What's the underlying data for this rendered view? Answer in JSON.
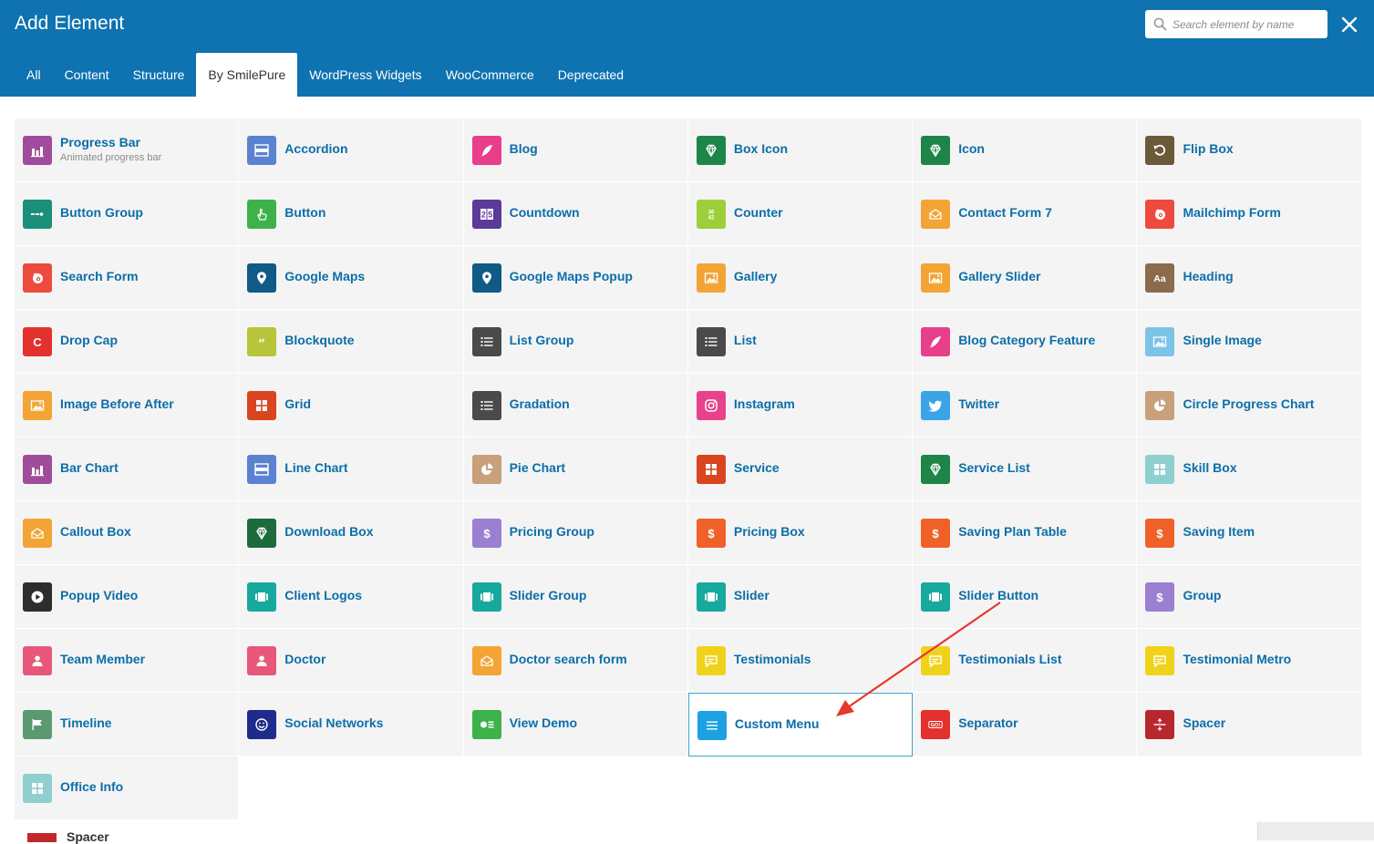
{
  "window": {
    "title": "Add Element"
  },
  "search": {
    "placeholder": "Search element by name"
  },
  "tabs": [
    "All",
    "Content",
    "Structure",
    "By SmilePure",
    "WordPress Widgets",
    "WooCommerce",
    "Deprecated"
  ],
  "active_tab": "By SmilePure",
  "colors": {
    "header": "#0e73b0",
    "label": "#0b6ea8",
    "selected_border": "#36a3cd",
    "arrow": "#e8372c"
  },
  "elements": [
    {
      "label": "Progress Bar",
      "desc": "Animated progress bar",
      "color": "#a14b9c",
      "icon": "bar-chart-icon"
    },
    {
      "label": "Accordion",
      "color": "#5a82d1",
      "icon": "accordion-icon"
    },
    {
      "label": "Blog",
      "color": "#e83f8a",
      "icon": "feather-icon"
    },
    {
      "label": "Box Icon",
      "color": "#1d8547",
      "icon": "diamond-icon"
    },
    {
      "label": "Icon",
      "color": "#1d8547",
      "icon": "diamond-icon"
    },
    {
      "label": "Flip Box",
      "color": "#6b5a3a",
      "icon": "rotate-icon"
    },
    {
      "label": "Button Group",
      "color": "#1a8f7a",
      "icon": "button-group-icon"
    },
    {
      "label": "Button",
      "color": "#3db24a",
      "icon": "hand-pointer-icon"
    },
    {
      "label": "Countdown",
      "color": "#5b3a9a",
      "icon": "countdown-icon"
    },
    {
      "label": "Counter",
      "color": "#9dcf3a",
      "icon": "counter-icon"
    },
    {
      "label": "Contact Form 7",
      "color": "#f2a534",
      "icon": "envelope-icon"
    },
    {
      "label": "Mailchimp Form",
      "color": "#ee4b3f",
      "icon": "mailchimp-icon"
    },
    {
      "label": "Search Form",
      "color": "#ee4b3f",
      "icon": "mailchimp-icon"
    },
    {
      "label": "Google Maps",
      "color": "#0f5a86",
      "icon": "map-pin-icon"
    },
    {
      "label": "Google Maps Popup",
      "color": "#0f5a86",
      "icon": "map-pin-icon"
    },
    {
      "label": "Gallery",
      "color": "#f2a534",
      "icon": "image-icon"
    },
    {
      "label": "Gallery Slider",
      "color": "#f2a534",
      "icon": "image-icon"
    },
    {
      "label": "Heading",
      "color": "#8a6b4c",
      "icon": "text-icon"
    },
    {
      "label": "Drop Cap",
      "color": "#e3312d",
      "icon": "letter-c-icon"
    },
    {
      "label": "Blockquote",
      "color": "#b8c43a",
      "icon": "quote-icon"
    },
    {
      "label": "List Group",
      "color": "#4a4a4a",
      "icon": "list-icon"
    },
    {
      "label": "List",
      "color": "#4a4a4a",
      "icon": "list-icon"
    },
    {
      "label": "Blog Category Feature",
      "color": "#e83f8a",
      "icon": "feather-icon"
    },
    {
      "label": "Single Image",
      "color": "#7cc3e8",
      "icon": "image-icon"
    },
    {
      "label": "Image Before After",
      "color": "#f2a534",
      "icon": "image-icon"
    },
    {
      "label": "Grid",
      "color": "#d9451e",
      "icon": "grid-icon"
    },
    {
      "label": "Gradation",
      "color": "#4a4a4a",
      "icon": "list-icon"
    },
    {
      "label": "Instagram",
      "color": "#e8428c",
      "icon": "instagram-icon"
    },
    {
      "label": "Twitter",
      "color": "#3aa4e6",
      "icon": "twitter-icon"
    },
    {
      "label": "Circle Progress Chart",
      "color": "#c8a07a",
      "icon": "pie-icon"
    },
    {
      "label": "Bar Chart",
      "color": "#a14b9c",
      "icon": "bar-chart-icon"
    },
    {
      "label": "Line Chart",
      "color": "#5a82d1",
      "icon": "accordion-icon"
    },
    {
      "label": "Pie Chart",
      "color": "#c8a07a",
      "icon": "pie-icon"
    },
    {
      "label": "Service",
      "color": "#d9451e",
      "icon": "grid-icon"
    },
    {
      "label": "Service List",
      "color": "#1d8547",
      "icon": "diamond-icon"
    },
    {
      "label": "Skill Box",
      "color": "#8fcfcf",
      "icon": "grid-icon"
    },
    {
      "label": "Callout Box",
      "color": "#f2a534",
      "icon": "envelope-icon"
    },
    {
      "label": "Download Box",
      "color": "#1d6b3c",
      "icon": "diamond-icon"
    },
    {
      "label": "Pricing Group",
      "color": "#9b7fd0",
      "icon": "dollar-icon"
    },
    {
      "label": "Pricing Box",
      "color": "#f0612a",
      "icon": "dollar-icon"
    },
    {
      "label": "Saving Plan Table",
      "color": "#f0612a",
      "icon": "dollar-icon"
    },
    {
      "label": "Saving Item",
      "color": "#f0612a",
      "icon": "dollar-icon"
    },
    {
      "label": "Popup Video",
      "color": "#2d2d2d",
      "icon": "play-icon"
    },
    {
      "label": "Client Logos",
      "color": "#17a89e",
      "icon": "slider-icon"
    },
    {
      "label": "Slider Group",
      "color": "#17a89e",
      "icon": "slider-icon"
    },
    {
      "label": "Slider",
      "color": "#17a89e",
      "icon": "slider-icon"
    },
    {
      "label": "Slider Button",
      "color": "#17a89e",
      "icon": "slider-icon"
    },
    {
      "label": "Group",
      "color": "#9b7fd0",
      "icon": "dollar-icon"
    },
    {
      "label": "Team Member",
      "color": "#e8577a",
      "icon": "user-icon"
    },
    {
      "label": "Doctor",
      "color": "#e8577a",
      "icon": "user-icon"
    },
    {
      "label": "Doctor search form",
      "color": "#f2a534",
      "icon": "envelope-icon"
    },
    {
      "label": "Testimonials",
      "color": "#f0d21a",
      "icon": "comment-icon"
    },
    {
      "label": "Testimonials List",
      "color": "#f0d21a",
      "icon": "comment-icon"
    },
    {
      "label": "Testimonial Metro",
      "color": "#f0d21a",
      "icon": "comment-icon"
    },
    {
      "label": "Timeline",
      "color": "#5a9a6e",
      "icon": "flag-icon"
    },
    {
      "label": "Social Networks",
      "color": "#1e2b8a",
      "icon": "smile-icon"
    },
    {
      "label": "View Demo",
      "color": "#3db24a",
      "icon": "view-demo-icon"
    },
    {
      "label": "Custom Menu",
      "color": "#1da1e2",
      "icon": "menu-icon",
      "selected": true
    },
    {
      "label": "Separator",
      "color": "#e3312d",
      "icon": "go-icon",
      "badge": "GO!"
    },
    {
      "label": "Spacer",
      "color": "#b7282e",
      "icon": "spacer-icon"
    },
    {
      "label": "Office Info",
      "color": "#8fcfcf",
      "icon": "grid-icon"
    }
  ],
  "background_peek": {
    "label": "Spacer"
  }
}
